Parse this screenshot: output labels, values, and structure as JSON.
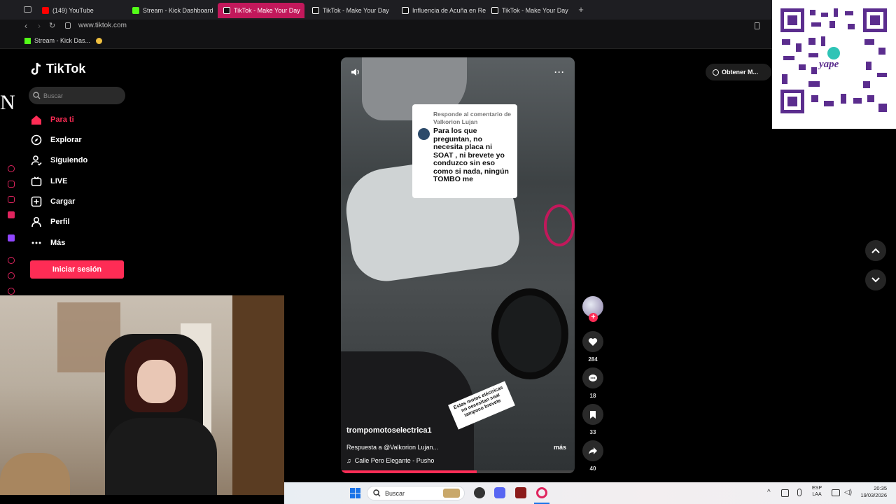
{
  "tabs": [
    {
      "label": "(149) YouTube",
      "color": "#ff0000"
    },
    {
      "label": "Stream - Kick Dashboard",
      "color": "#53fc18"
    },
    {
      "label": "TikTok - Make Your Day",
      "color": "#ffffff",
      "active": true
    },
    {
      "label": "TikTok - Make Your Day",
      "color": "#ffffff"
    },
    {
      "label": "Influencia de Acuña en Re",
      "color": "#ffffff"
    },
    {
      "label": "TikTok - Make Your Day",
      "color": "#ffffff"
    }
  ],
  "address": {
    "url": "www.tiktok.com"
  },
  "bookmarks": [
    {
      "label": "Stream - Kick Das..."
    }
  ],
  "tiktok": {
    "logo": "TikTok",
    "search_placeholder": "Buscar",
    "nav": [
      {
        "label": "Para ti",
        "icon": "home-icon"
      },
      {
        "label": "Explorar",
        "icon": "compass-icon"
      },
      {
        "label": "Siguiendo",
        "icon": "following-icon"
      },
      {
        "label": "LIVE",
        "icon": "live-icon"
      },
      {
        "label": "Cargar",
        "icon": "upload-icon"
      },
      {
        "label": "Perfil",
        "icon": "profile-icon"
      },
      {
        "label": "Más",
        "icon": "more-icon"
      }
    ],
    "login_button": "Iniciar sesión",
    "get_app": "Obtener M...",
    "accent": "#fe2c55"
  },
  "video": {
    "comment_header": "Responde al comentario de Valkorion Lujan",
    "comment_text": "Para los que preguntan, no necesita placa ni SOAT , ni brevete yo conduzco sin eso como si nada, ningún TOMBO me",
    "sticker_text": "Estas motos eléctricas no necesitan soat tampoco brevete",
    "username": "trompomotoselectrica1",
    "caption": "Respuesta a @Valkorion Lujan...",
    "more": "más",
    "sound": "Calle Pero Elegante - Pusho",
    "likes": "284",
    "comments": "18",
    "saves": "33",
    "shares": "40",
    "progress": 0.58
  },
  "overlay": {
    "stream_letter": "N",
    "qr_brand": "yape"
  },
  "taskbar": {
    "search": "Buscar",
    "lang": "ESP",
    "lang2": "LAA",
    "time": "20:35",
    "date": "19/03/2026"
  }
}
